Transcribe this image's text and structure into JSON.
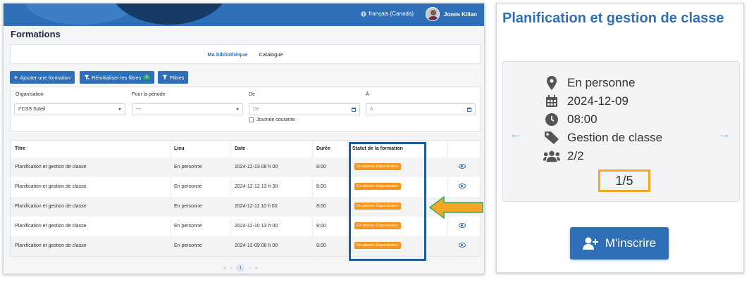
{
  "left": {
    "header": {
      "language": "français (Canada)",
      "user_name": "Jones Kilian"
    },
    "page_title": "Formations",
    "tabs": [
      {
        "label": "Ma bibliothèque",
        "active": true
      },
      {
        "label": "Catalogue",
        "active": false
      }
    ],
    "toolbar": {
      "add_label": "Ajouter une formation",
      "reset_label": "Réinitialiser les filtres",
      "reset_badge": "2",
      "filters_label": "Filtres"
    },
    "filters": {
      "organisation_label": "Organisation",
      "organisation_value": "I*CSS Soleil",
      "period_label": "Pour la période",
      "period_value": "---",
      "from_label": "De",
      "from_placeholder": "De",
      "to_label": "À",
      "to_placeholder": "À",
      "today_label": "Journée courante"
    },
    "table": {
      "columns": [
        "Titre",
        "Lieu",
        "Date",
        "Durée",
        "Statut de la formation"
      ],
      "rows": [
        {
          "title": "Planification et gestion de classe",
          "place": "En personne",
          "date": "2024-12-13 08 h 00",
          "duration": "8:00",
          "status": "En attente d'approbation"
        },
        {
          "title": "Planification et gestion de classe",
          "place": "En personne",
          "date": "2024-12-12 13 h 30",
          "duration": "8:00",
          "status": "En attente d'approbation"
        },
        {
          "title": "Planification et gestion de classe",
          "place": "En personne",
          "date": "2024-12-11 10 h 00",
          "duration": "8:00",
          "status": "En attente d'approbation"
        },
        {
          "title": "Planification et gestion de classe",
          "place": "En personne",
          "date": "2024-12-10 13 h 00",
          "duration": "8:00",
          "status": "En attente d'approbation"
        },
        {
          "title": "Planification et gestion de classe",
          "place": "En personne",
          "date": "2024-12-09 08 h 00",
          "duration": "8:00",
          "status": "En attente d'approbation"
        }
      ]
    },
    "pagination": {
      "current_page": "1",
      "first": "«",
      "prev": "‹",
      "next": "›",
      "last": "»"
    }
  },
  "right": {
    "title": "Planification et gestion de classe",
    "details": {
      "location": "En personne",
      "date": "2024-12-09",
      "time": "08:00",
      "category": "Gestion de classe",
      "seats": "2/2"
    },
    "counter": "1/5",
    "prev_arrow": "←",
    "next_arrow": "→",
    "register_label": "M'inscrire"
  },
  "colors": {
    "brand_blue": "#2f6fb7",
    "status_orange": "#f7941d",
    "highlight_navy": "#1f5b96",
    "annotation_orange": "#f5a623",
    "badge_green": "#2fae64"
  },
  "icons": [
    "globe-icon",
    "plus-icon",
    "filter-reset-icon",
    "filter-icon",
    "calendar-icon",
    "eye-icon",
    "location-pin-icon",
    "clock-icon",
    "tag-icon",
    "users-icon",
    "user-plus-icon"
  ]
}
